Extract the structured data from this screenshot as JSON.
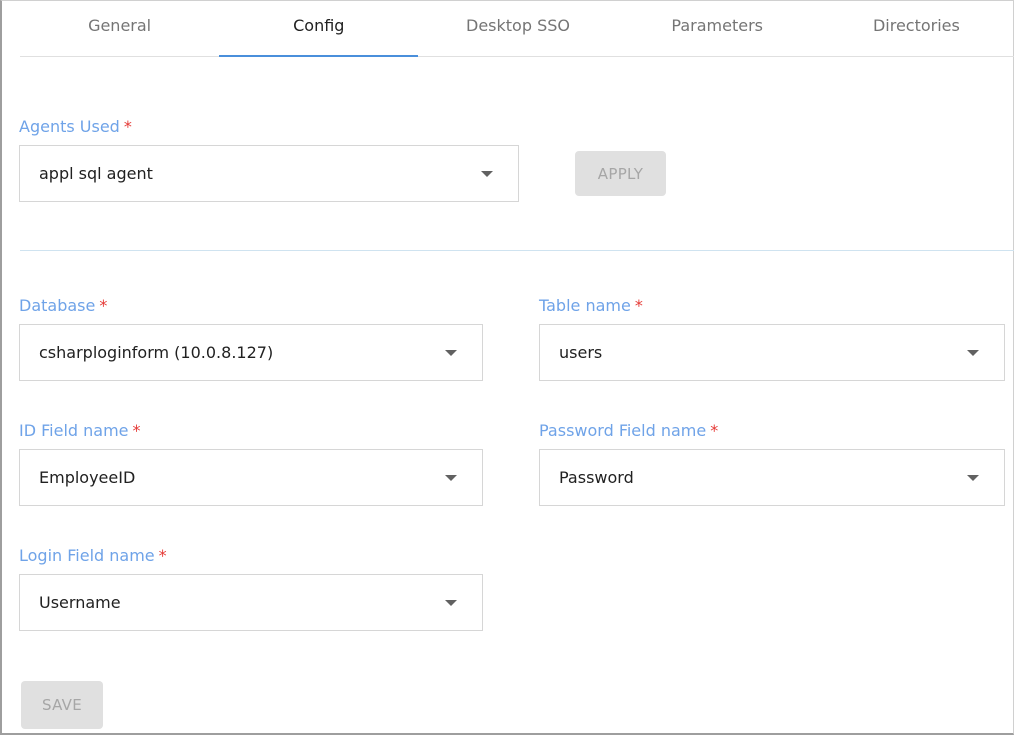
{
  "tabs": [
    {
      "label": "General"
    },
    {
      "label": "Config"
    },
    {
      "label": "Desktop SSO"
    },
    {
      "label": "Parameters"
    },
    {
      "label": "Directories"
    }
  ],
  "active_tab": "Config",
  "agents": {
    "label": "Agents Used",
    "required": "*",
    "value": "appl sql agent",
    "apply_label": "APPLY"
  },
  "database": {
    "label": "Database",
    "required": "*",
    "value": "csharploginform (10.0.8.127)"
  },
  "table_name": {
    "label": "Table name",
    "required": "*",
    "value": "users"
  },
  "id_field": {
    "label": "ID Field name",
    "required": "*",
    "value": "EmployeeID"
  },
  "password_field": {
    "label": "Password Field name",
    "required": "*",
    "value": "Password"
  },
  "login_field": {
    "label": "Login Field name",
    "required": "*",
    "value": "Username"
  },
  "save_label": "SAVE",
  "colors": {
    "accent": "#4a8fdb",
    "label": "#6fa3e8",
    "required": "#e53935",
    "disabled_button": "#e0e0e0"
  },
  "icons": {
    "dropdown": "caret-down-icon"
  }
}
